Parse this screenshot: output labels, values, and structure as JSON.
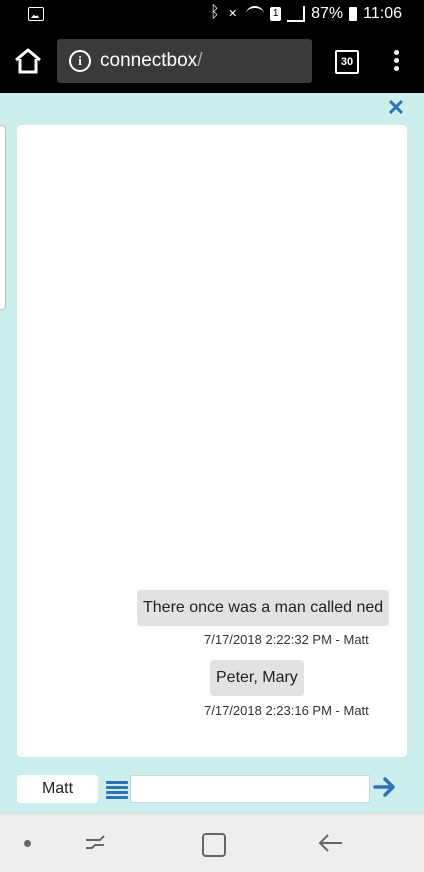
{
  "status_bar": {
    "battery_percent": "87%",
    "time": "11:06",
    "sim_slot": "1"
  },
  "browser": {
    "url_host": "connectbox",
    "url_suffix": "/",
    "tab_count": "30"
  },
  "chat": {
    "messages": [
      {
        "text": "There once was a man called ned",
        "meta": "7/17/2018 2:22:32 PM - Matt"
      },
      {
        "text": "Peter, Mary",
        "meta": "7/17/2018 2:23:16 PM - Matt"
      }
    ]
  },
  "composer": {
    "name": "Matt",
    "message_value": ""
  },
  "colors": {
    "page_background": "#cceeed",
    "accent": "#2e74b5",
    "bubble": "#e2e2e2"
  },
  "icons": [
    "gallery-icon",
    "bluetooth-icon",
    "mute-icon",
    "wifi-icon",
    "signal-icon",
    "battery-icon",
    "home-icon",
    "info-icon",
    "tabs-icon",
    "menu-icon",
    "close-icon",
    "list-icon",
    "send-arrow-icon",
    "recents-icon",
    "back-icon"
  ]
}
